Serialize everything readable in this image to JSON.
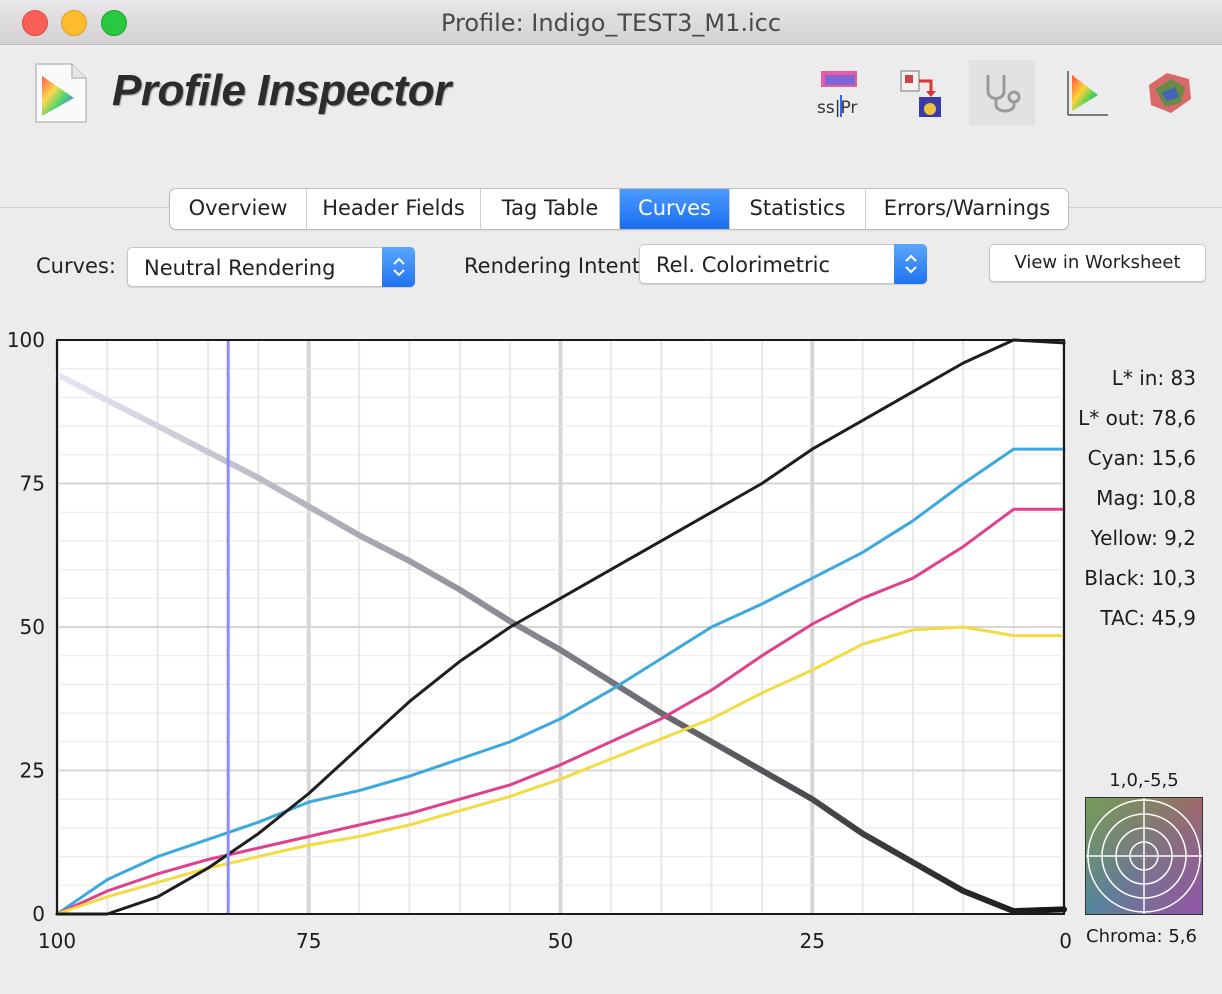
{
  "window": {
    "title": "Profile: Indigo_TEST3_M1.icc"
  },
  "app": {
    "name": "Profile Inspector"
  },
  "toolbar_icons": [
    "gamut-3d-icon",
    "profile-link-icon",
    "stethoscope-icon",
    "gamut-triangle-icon",
    "gamut-compare-icon"
  ],
  "tool_text": "ss|Pr",
  "tabs": [
    {
      "label": "Overview"
    },
    {
      "label": "Header Fields"
    },
    {
      "label": "Tag Table"
    },
    {
      "label": "Curves",
      "active": true
    },
    {
      "label": "Statistics"
    },
    {
      "label": "Errors/Warnings"
    }
  ],
  "controls": {
    "curves_label": "Curves:",
    "curves_value": "Neutral Rendering",
    "intent_label": "Rendering Intent:",
    "intent_value": "Rel. Colorimetric",
    "worksheet_button": "View in Worksheet"
  },
  "readouts": {
    "lstar_in": "L* in: 83",
    "lstar_out": "L* out: 78,6",
    "cyan": "Cyan: 15,6",
    "mag": "Mag: 10,8",
    "yellow": "Yellow: 9,2",
    "black": "Black: 10,3",
    "tac": "TAC: 45,9",
    "lab": "1,0,-5,5",
    "chroma": "Chroma:  5,6"
  },
  "colors": {
    "cyan": "#3ba9e0",
    "magenta": "#e0418f",
    "yellow": "#f2dc42",
    "black": "#1e1e1e",
    "cursor": "#8c8cff",
    "accent": "#1a6ef0"
  },
  "chart_data": {
    "type": "line",
    "x_reversed": true,
    "xlim": [
      0,
      100
    ],
    "ylim": [
      0,
      100
    ],
    "x_ticks": [
      "100",
      "75",
      "50",
      "25",
      "0"
    ],
    "y_ticks": [
      "100",
      "75",
      "50",
      "25",
      "0"
    ],
    "cursor_x": 83,
    "grid": true,
    "series": [
      {
        "key": "lstar",
        "color": "#7a7a7a",
        "x": [
          100,
          95,
          90,
          85,
          80,
          75,
          70,
          65,
          60,
          55,
          50,
          45,
          40,
          35,
          30,
          25,
          20,
          15,
          10,
          5,
          0
        ],
        "y": [
          94,
          89.5,
          85,
          80.5,
          76,
          71,
          66,
          61.5,
          56.5,
          51,
          46,
          40.5,
          35,
          30,
          25,
          20,
          14,
          9,
          4,
          0.5,
          0.8
        ]
      },
      {
        "key": "cyan",
        "color": "#3ba9e0",
        "x": [
          100,
          95,
          90,
          85,
          80,
          75,
          70,
          65,
          60,
          55,
          50,
          45,
          40,
          35,
          30,
          25,
          20,
          15,
          10,
          5,
          0
        ],
        "y": [
          0,
          6,
          10,
          13,
          16,
          19.5,
          21.5,
          24,
          27,
          30,
          34,
          39,
          44.5,
          50,
          54,
          58.5,
          63,
          68.5,
          75,
          81,
          81
        ]
      },
      {
        "key": "magenta",
        "color": "#e0418f",
        "x": [
          100,
          95,
          90,
          85,
          80,
          75,
          70,
          65,
          60,
          55,
          50,
          45,
          40,
          35,
          30,
          25,
          20,
          15,
          10,
          5,
          0
        ],
        "y": [
          0,
          4,
          7,
          9.5,
          11.5,
          13.5,
          15.5,
          17.5,
          20,
          22.5,
          26,
          30,
          34,
          39,
          45,
          50.5,
          55,
          58.5,
          64,
          70.5,
          70.5
        ]
      },
      {
        "key": "yellow",
        "color": "#f2dc42",
        "x": [
          100,
          95,
          90,
          85,
          80,
          75,
          70,
          65,
          60,
          55,
          50,
          45,
          40,
          35,
          30,
          25,
          20,
          15,
          10,
          5,
          0
        ],
        "y": [
          0,
          3,
          5.5,
          8,
          10,
          12,
          13.5,
          15.5,
          18,
          20.5,
          23.5,
          27,
          30.5,
          34,
          38.5,
          42.5,
          47,
          49.5,
          50,
          48.5,
          48.5
        ]
      },
      {
        "key": "black",
        "color": "#1e1e1e",
        "x": [
          100,
          95,
          90,
          85,
          80,
          75,
          70,
          65,
          60,
          55,
          50,
          45,
          40,
          35,
          30,
          25,
          20,
          15,
          10,
          5,
          0
        ],
        "y": [
          0,
          0,
          3,
          8,
          14,
          21,
          29,
          37,
          44,
          50,
          55,
          60,
          65,
          70,
          75,
          81,
          86,
          91,
          96,
          100,
          99.5
        ]
      }
    ]
  }
}
